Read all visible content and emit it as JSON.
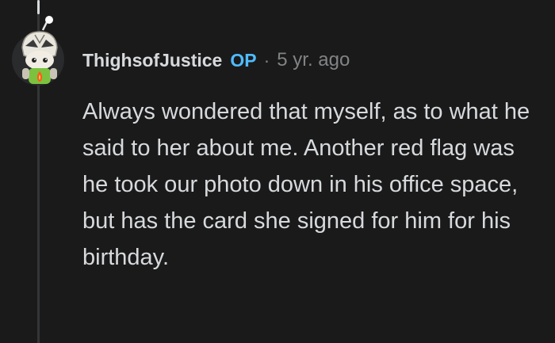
{
  "comment": {
    "username": "ThighsofJustice",
    "op_badge": "OP",
    "separator": "·",
    "time_ago": "5 yr. ago",
    "body": "Always wondered that myself, as to what he said to her about me. Another red flag was he took our photo down in his office space, but has the card she signed for him for his birthday."
  },
  "avatar": {
    "icon": "snoo-avatar-icon"
  },
  "colors": {
    "background": "#1a1a1b",
    "text": "#d7dadc",
    "muted": "#818384",
    "op_accent": "#4fbcff",
    "thread_line": "#343536"
  }
}
